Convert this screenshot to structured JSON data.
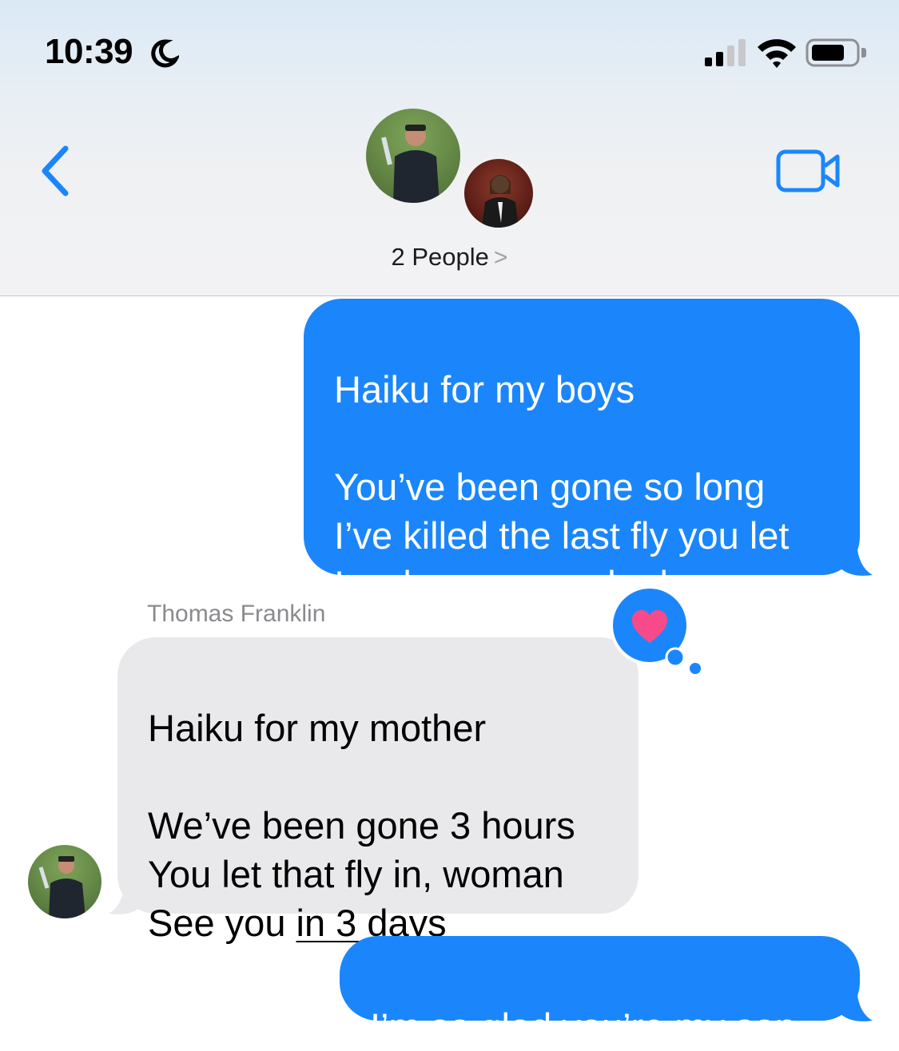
{
  "status_bar": {
    "time": "10:39",
    "icons": [
      "moon-icon",
      "signal-icon",
      "wifi-icon",
      "battery-icon"
    ]
  },
  "header": {
    "back_icon": "chevron-left-icon",
    "group_label": "2 People",
    "group_chevron": ">",
    "video_icon": "video-camera-icon"
  },
  "colors": {
    "sent_bubble": "#1b86fb",
    "received_bubble": "#e9e9eb",
    "accent": "#1b86fb",
    "heart": "#f74a8a"
  },
  "messages": [
    {
      "direction": "sent",
      "text": "Haiku for my boys\n\nYou’ve been gone so long\nI’ve killed the last fly you let\nIn when you packed up"
    },
    {
      "direction": "received",
      "sender": "Thomas Franklin",
      "reaction": "heart-icon",
      "text_before_link": "Haiku for my mother\n\nWe’ve been gone 3 hours\nYou let that fly in, woman\nSee you ",
      "link_text": "in 3 days"
    },
    {
      "direction": "sent",
      "text": "I’m so glad you’re my son"
    }
  ]
}
